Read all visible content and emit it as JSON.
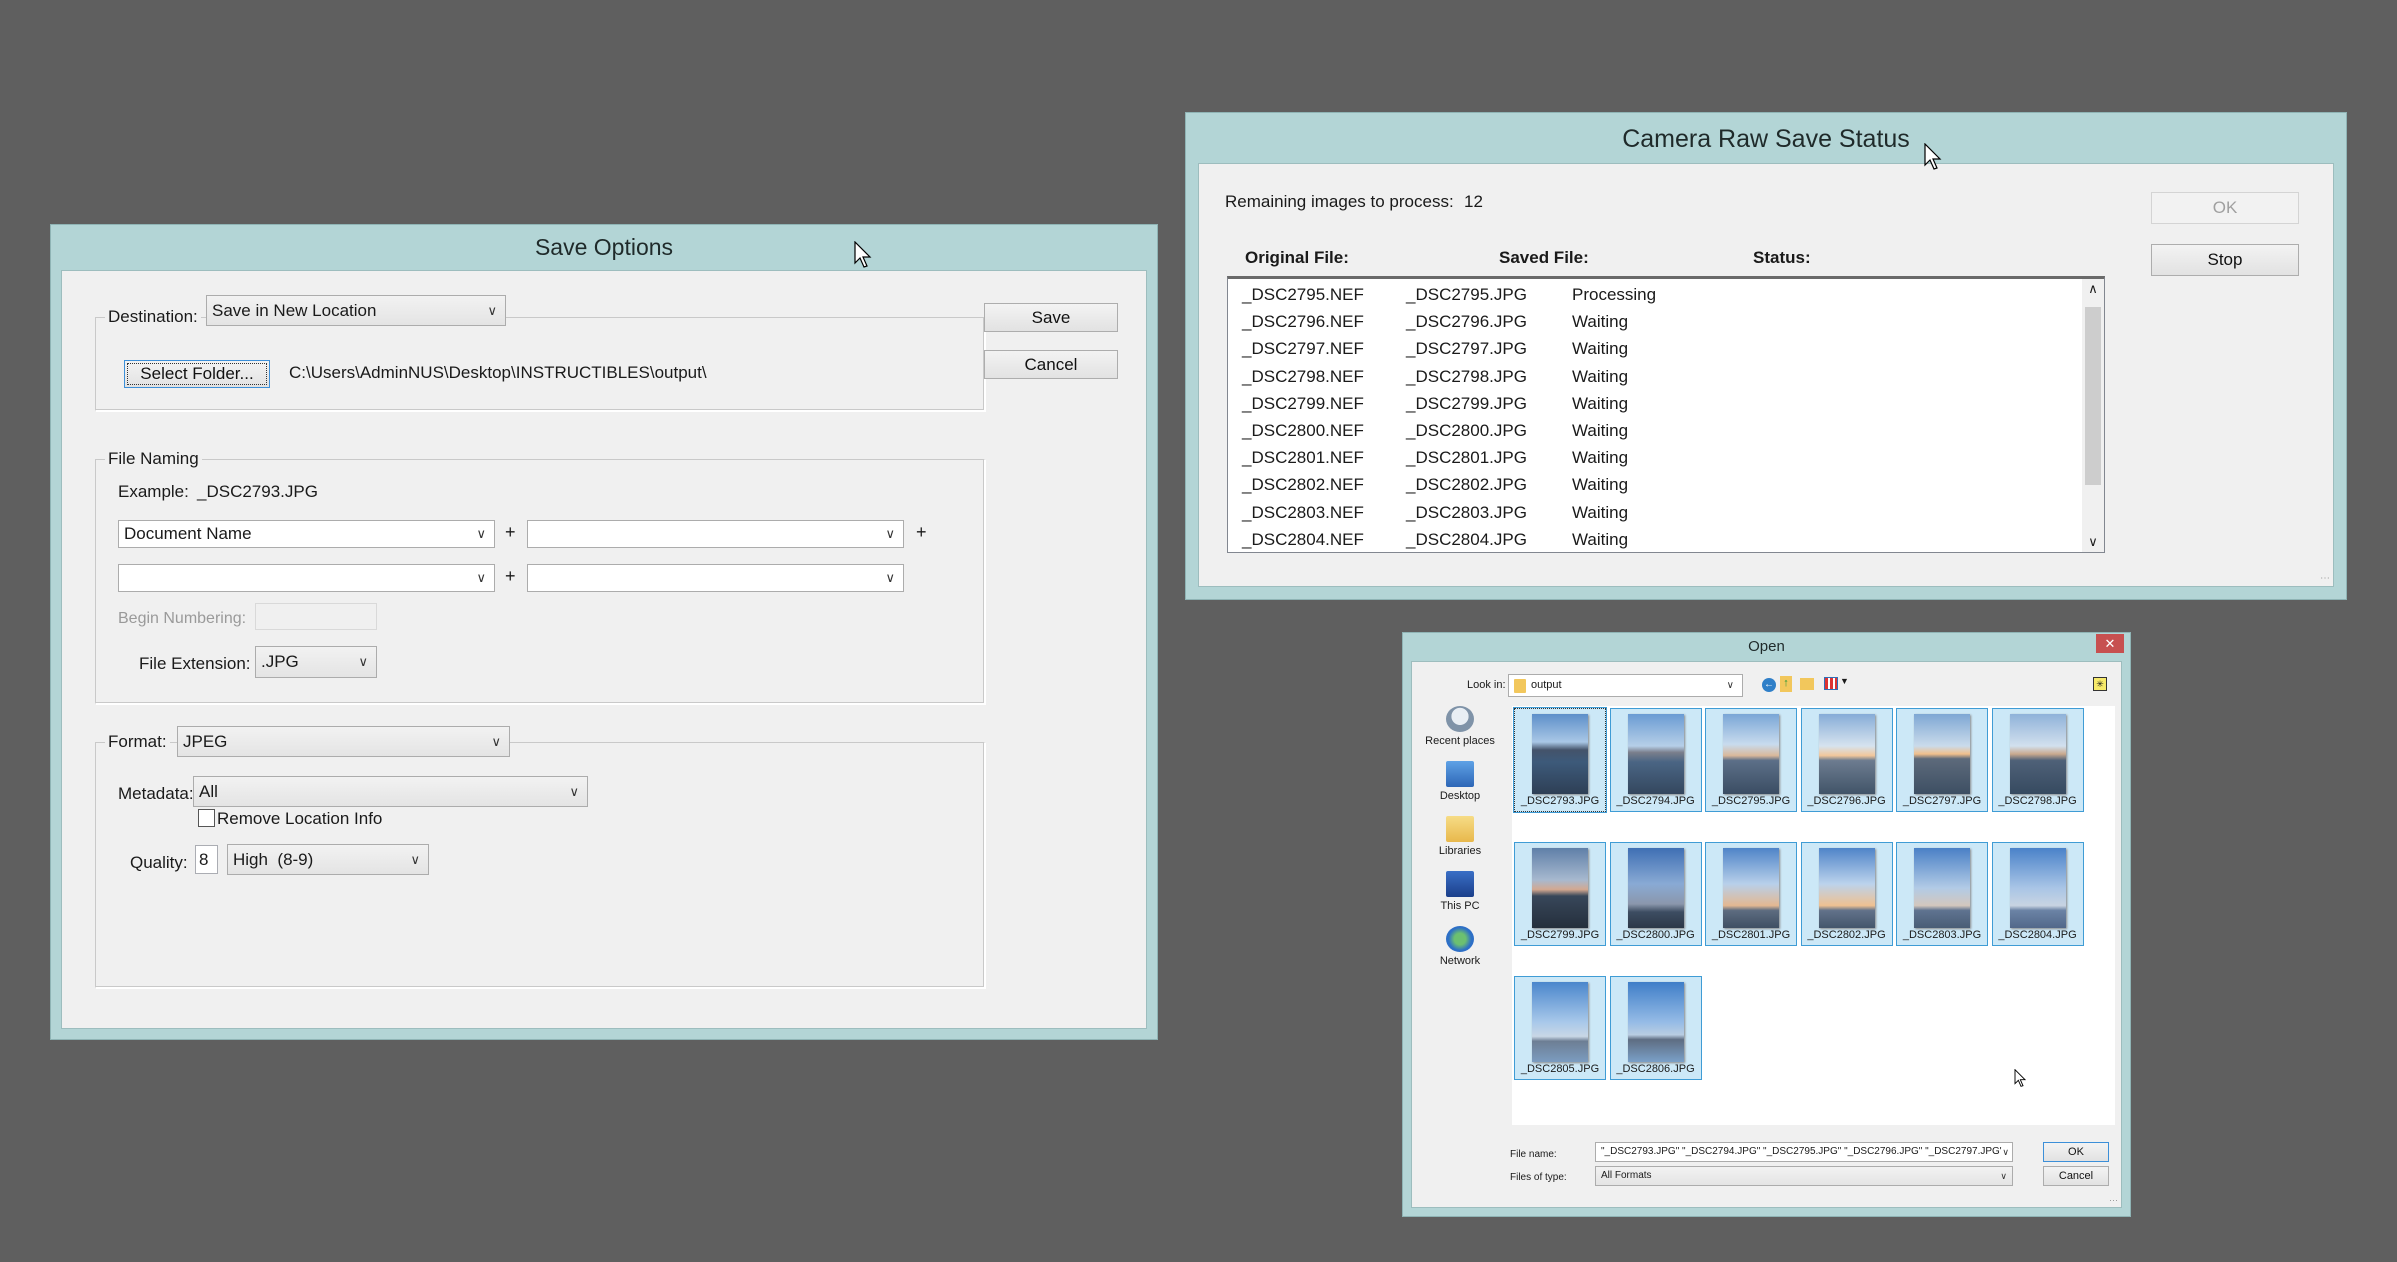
{
  "save_options": {
    "title": "Save Options",
    "destination_label": "Destination:",
    "destination_value": "Save in New Location",
    "select_folder_label": "Select Folder...",
    "folder_path": "C:\\Users\\AdminNUS\\Desktop\\INSTRUCTIBLES\\output\\",
    "save_label": "Save",
    "cancel_label": "Cancel",
    "file_naming_label": "File Naming",
    "example_label": "Example:",
    "example_value": "_DSC2793.JPG",
    "naming_fields": [
      "Document Name",
      "",
      "",
      ""
    ],
    "plus": "+",
    "begin_numbering_label": "Begin Numbering:",
    "begin_numbering_value": "",
    "file_extension_label": "File Extension:",
    "file_extension_value": ".JPG",
    "format_label": "Format:",
    "format_value": "JPEG",
    "metadata_label": "Metadata:",
    "metadata_value": "All",
    "remove_location_label": "Remove Location Info",
    "remove_location_checked": false,
    "quality_label": "Quality:",
    "quality_value": "8",
    "quality_preset": "High  (8-9)"
  },
  "camera_raw_status": {
    "title": "Camera Raw Save Status",
    "remaining_label": "Remaining images to process:",
    "remaining_value": "12",
    "ok_label": "OK",
    "stop_label": "Stop",
    "columns": [
      "Original File:",
      "Saved File:",
      "Status:"
    ],
    "rows": [
      {
        "original": "_DSC2795.NEF",
        "saved": "_DSC2795.JPG",
        "status": "Processing"
      },
      {
        "original": "_DSC2796.NEF",
        "saved": "_DSC2796.JPG",
        "status": "Waiting"
      },
      {
        "original": "_DSC2797.NEF",
        "saved": "_DSC2797.JPG",
        "status": "Waiting"
      },
      {
        "original": "_DSC2798.NEF",
        "saved": "_DSC2798.JPG",
        "status": "Waiting"
      },
      {
        "original": "_DSC2799.NEF",
        "saved": "_DSC2799.JPG",
        "status": "Waiting"
      },
      {
        "original": "_DSC2800.NEF",
        "saved": "_DSC2800.JPG",
        "status": "Waiting"
      },
      {
        "original": "_DSC2801.NEF",
        "saved": "_DSC2801.JPG",
        "status": "Waiting"
      },
      {
        "original": "_DSC2802.NEF",
        "saved": "_DSC2802.JPG",
        "status": "Waiting"
      },
      {
        "original": "_DSC2803.NEF",
        "saved": "_DSC2803.JPG",
        "status": "Waiting"
      },
      {
        "original": "_DSC2804.NEF",
        "saved": "_DSC2804.JPG",
        "status": "Waiting"
      }
    ]
  },
  "open_dialog": {
    "title": "Open",
    "look_in_label": "Look in:",
    "look_in_value": "output",
    "places": [
      "Recent places",
      "Desktop",
      "Libraries",
      "This PC",
      "Network"
    ],
    "files": [
      "_DSC2793.JPG",
      "_DSC2794.JPG",
      "_DSC2795.JPG",
      "_DSC2796.JPG",
      "_DSC2797.JPG",
      "_DSC2798.JPG",
      "_DSC2799.JPG",
      "_DSC2800.JPG",
      "_DSC2801.JPG",
      "_DSC2802.JPG",
      "_DSC2803.JPG",
      "_DSC2804.JPG",
      "_DSC2805.JPG",
      "_DSC2806.JPG"
    ],
    "file_name_label": "File name:",
    "file_name_value": "\"_DSC2793.JPG\" \"_DSC2794.JPG\" \"_DSC2795.JPG\" \"_DSC2796.JPG\" \"_DSC2797.JPG\"",
    "files_of_type_label": "Files of type:",
    "files_of_type_value": "All Formats",
    "ok_label": "OK",
    "cancel_label": "Cancel",
    "close_label": "✕"
  },
  "colors": {
    "desktop": "#5f5f5f",
    "window_frame": "#b3d5d6",
    "close_button": "#c75050",
    "selection": "#cce8f7"
  }
}
